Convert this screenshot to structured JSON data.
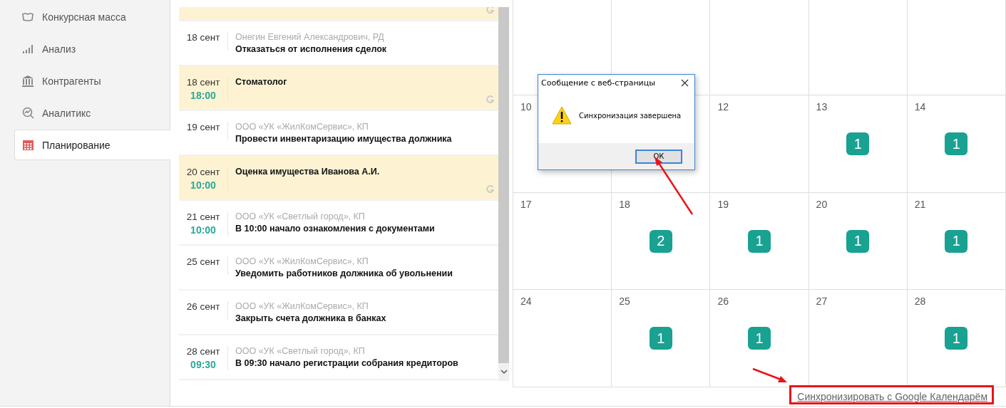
{
  "sidebar": {
    "items": [
      {
        "kind": "wallet",
        "label": "Конкурсная масса",
        "selected": false
      },
      {
        "kind": "bars",
        "label": "Анализ",
        "selected": false
      },
      {
        "kind": "bank",
        "label": "Контрагенты",
        "selected": false
      },
      {
        "kind": "magnifier",
        "label": "Аналитикс",
        "selected": false
      },
      {
        "kind": "calendar",
        "label": "Планирование",
        "selected": true
      }
    ]
  },
  "events": [
    {
      "google": true
    },
    {
      "date": "18 сент",
      "client": "Онегин Евгений Александрович, РД",
      "title": "Отказаться от исполнения сделок",
      "google": false
    },
    {
      "date": "18 сент",
      "time": "18:00",
      "title": "Стоматолог",
      "google": true
    },
    {
      "date": "19 сент",
      "client": "ООО «УК «ЖилКомСервис», КП",
      "title": "Провести инвентаризацию имущества должника",
      "google": false
    },
    {
      "date": "20 сент",
      "time": "10:00",
      "title": "Оценка имущества Иванова А.И.",
      "google": true
    },
    {
      "date": "21 сент",
      "time": "10:00",
      "client": "ООО «УК «Светлый город», КП",
      "title": "В 10:00 начало ознакомления с документами",
      "google": false
    },
    {
      "date": "25 сент",
      "client": "ООО «УК «ЖилКомСервис», КП",
      "title": "Уведомить работников должника об увольнении",
      "google": false
    },
    {
      "date": "26 сент",
      "client": "ООО «УК «ЖилКомСервис», КП",
      "title": "Закрыть счета должника в банках",
      "google": false
    },
    {
      "date": "28 сент",
      "time": "09:30",
      "client": "ООО «УК «Светлый город», КП",
      "title": "В 09:30 начало регистрации собрания кредиторов",
      "google": false
    }
  ],
  "calendar": {
    "weeks": [
      [
        {
          "kind": "day",
          "day": "10"
        },
        {
          "kind": "blank"
        },
        {
          "kind": "day",
          "day": "12"
        },
        {
          "kind": "day",
          "day": "13",
          "count": "1"
        },
        {
          "kind": "day",
          "day": "14",
          "count": "1"
        }
      ],
      [
        {
          "kind": "day",
          "day": "17"
        },
        {
          "kind": "day",
          "day": "18",
          "count": "2"
        },
        {
          "kind": "day",
          "day": "19",
          "count": "1"
        },
        {
          "kind": "day",
          "day": "20",
          "count": "1"
        },
        {
          "kind": "day",
          "day": "21",
          "count": "1"
        }
      ],
      [
        {
          "kind": "day",
          "day": "24"
        },
        {
          "kind": "day",
          "day": "25",
          "count": "1"
        },
        {
          "kind": "day",
          "day": "26",
          "count": "1"
        },
        {
          "kind": "day",
          "day": "27"
        },
        {
          "kind": "day",
          "day": "28",
          "count": "1"
        }
      ]
    ],
    "sync_link": "Синхронизировать с Google Календарём"
  },
  "dialog": {
    "title": "Сообщение с веб-страницы",
    "message": "Синхронизация завершена",
    "button": "ОК"
  }
}
